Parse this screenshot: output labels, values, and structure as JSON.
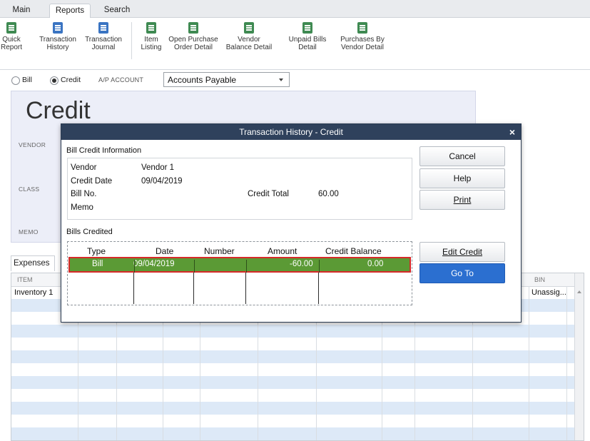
{
  "tabs": [
    "Main",
    "Reports",
    "Search"
  ],
  "active_tab": "Reports",
  "ribbon": [
    {
      "line1": "Quick",
      "line2": "Report",
      "icon": "quick-report-icon",
      "color": "#3f8a52"
    },
    {
      "line1": "Transaction",
      "line2": "History",
      "icon": "transaction-history-icon",
      "color": "#3a74c2"
    },
    {
      "line1": "Transaction",
      "line2": "Journal",
      "icon": "transaction-journal-icon",
      "color": "#3a74c2"
    },
    {
      "line1": "Item",
      "line2": "Listing",
      "icon": "item-listing-icon",
      "color": "#3f8a52"
    },
    {
      "line1": "Open Purchase",
      "line2": "Order Detail",
      "icon": "open-po-detail-icon",
      "color": "#3f8a52"
    },
    {
      "line1": "Vendor",
      "line2": "Balance Detail",
      "icon": "vendor-balance-icon",
      "color": "#3f8a52"
    },
    {
      "line1": "Unpaid Bills",
      "line2": "Detail",
      "icon": "unpaid-bills-icon",
      "color": "#3f8a52"
    },
    {
      "line1": "Purchases By",
      "line2": "Vendor Detail",
      "icon": "purchases-by-vendor-icon",
      "color": "#3f8a52"
    }
  ],
  "form": {
    "bill_label": "Bill",
    "credit_label": "Credit",
    "ap_account_label": "A/P ACCOUNT",
    "ap_account_value": "Accounts Payable",
    "title": "Credit",
    "vendor_label": "VENDOR",
    "class_label": "CLASS",
    "memo_label": "MEMO"
  },
  "expenses": {
    "tab_label": "Expenses",
    "header_item": "ITEM",
    "header_bin": "BIN",
    "first_item": "Inventory 1",
    "first_bin": "Unassig..."
  },
  "dialog": {
    "title": "Transaction History - Credit",
    "close": "×",
    "info_heading": "Bill Credit Information",
    "vendor_label": "Vendor",
    "vendor_value": "Vendor 1",
    "credit_date_label": "Credit Date",
    "credit_date_value": "09/04/2019",
    "bill_no_label": "Bill No.",
    "memo_label": "Memo",
    "credit_total_label": "Credit Total",
    "credit_total_value": "60.00",
    "bills_heading": "Bills Credited",
    "columns": [
      "Type",
      "Date",
      "Number",
      "Amount",
      "Credit Balance"
    ],
    "rows": [
      {
        "type": "Bill",
        "date": "09/04/2019",
        "number": "",
        "amount": "-60.00",
        "credit_balance": "0.00"
      }
    ],
    "buttons": {
      "cancel": "Cancel",
      "help": "Help",
      "print": "Print",
      "edit_credit": "Edit Credit",
      "go_to": "Go To"
    }
  },
  "colors": {
    "title_bar": "#2f415c",
    "selected_row": "#5b9a35",
    "selection_border": "#d62a2a",
    "primary_button": "#2b6fd0"
  }
}
